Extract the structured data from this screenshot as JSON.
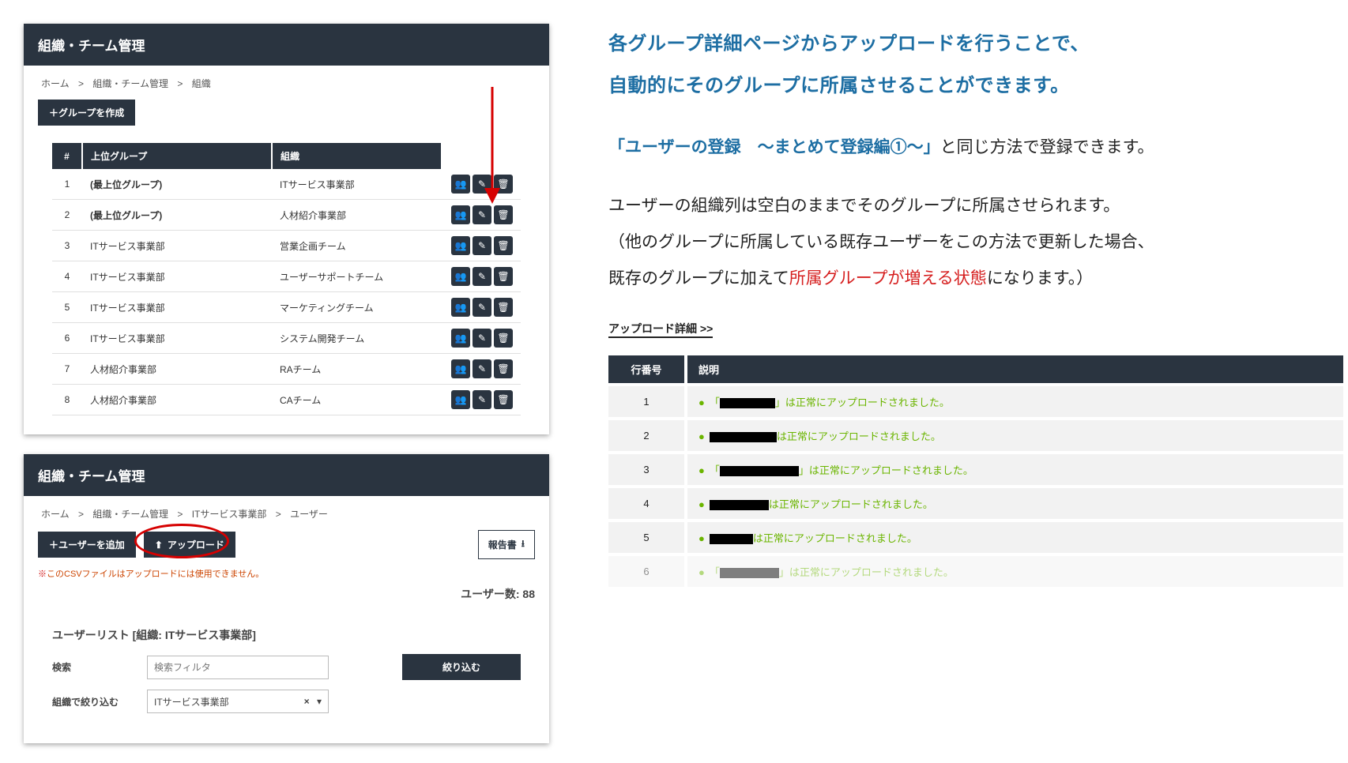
{
  "panel1": {
    "title": "組織・チーム管理",
    "breadcrumb": {
      "home": "ホーム",
      "sep": ">",
      "b2": "組織・チーム管理",
      "b3": "組織"
    },
    "create_group_btn": "＋グループを作成",
    "headers": {
      "idx": "#",
      "parent": "上位グループ",
      "org": "組織"
    },
    "rows": [
      {
        "idx": "1",
        "parent": "(最上位グループ)",
        "org": "ITサービス事業部",
        "bold": true
      },
      {
        "idx": "2",
        "parent": "(最上位グループ)",
        "org": "人材紹介事業部",
        "bold": true
      },
      {
        "idx": "3",
        "parent": "ITサービス事業部",
        "org": "営業企画チーム"
      },
      {
        "idx": "4",
        "parent": "ITサービス事業部",
        "org": "ユーザーサポートチーム"
      },
      {
        "idx": "5",
        "parent": "ITサービス事業部",
        "org": "マーケティングチーム"
      },
      {
        "idx": "6",
        "parent": "ITサービス事業部",
        "org": "システム開発チーム"
      },
      {
        "idx": "7",
        "parent": "人材紹介事業部",
        "org": "RAチーム"
      },
      {
        "idx": "8",
        "parent": "人材紹介事業部",
        "org": "CAチーム"
      }
    ]
  },
  "panel2": {
    "title": "組織・チーム管理",
    "breadcrumb": {
      "home": "ホーム",
      "sep": ">",
      "b2": "組織・チーム管理",
      "b3": "ITサービス事業部",
      "b4": "ユーザー"
    },
    "add_user_btn": "＋ユーザーを追加",
    "upload_btn": "アップロード",
    "report_btn": "報告書",
    "csv_note_prefix": "※",
    "csv_note": "このCSVファイルはアップロードには使用できません。",
    "user_count_label": "ユーザー数:",
    "user_count_value": "88",
    "list_title": "ユーザーリスト [組織: ITサービス事業部]",
    "search_label": "検索",
    "search_placeholder": "検索フィルタ",
    "narrow_btn": "絞り込む",
    "org_filter_label": "組織で絞り込む",
    "org_filter_value": "ITサービス事業部"
  },
  "right": {
    "blue1": "各グループ詳細ページからアップロードを行うことで、",
    "blue2": "自動的にそのグループに所属させることができます。",
    "line3_blue": "「ユーザーの登録　～まとめて登録編①～」",
    "line3_rest": "と同じ方法で登録できます。",
    "line4": "ユーザーの組織列は空白のままでそのグループに所属させられます。",
    "line5a": "（他のグループに所属している既存ユーザーをこの方法で更新した場合、",
    "line5b_pre": "既存のグループに加えて",
    "line5b_red": "所属グループが増える状態",
    "line5b_post": "になります。）",
    "upload_detail": "アップロード詳細 >>",
    "log_headers": {
      "row": "行番号",
      "desc": "説明"
    },
    "log_msg_pre": "「",
    "log_msg_post": "」は正常にアップロードされました。",
    "log_msg_post_noquote": "は正常にアップロードされました。",
    "log_rows": [
      {
        "n": "1",
        "quote": true,
        "redact_w": 70
      },
      {
        "n": "2",
        "quote": false,
        "redact_w": 85
      },
      {
        "n": "3",
        "quote": true,
        "redact_w": 100
      },
      {
        "n": "4",
        "quote": false,
        "redact_w": 75
      },
      {
        "n": "5",
        "quote": false,
        "redact_w": 55
      },
      {
        "n": "6",
        "quote": true,
        "redact_w": 75,
        "cut": true
      }
    ]
  }
}
